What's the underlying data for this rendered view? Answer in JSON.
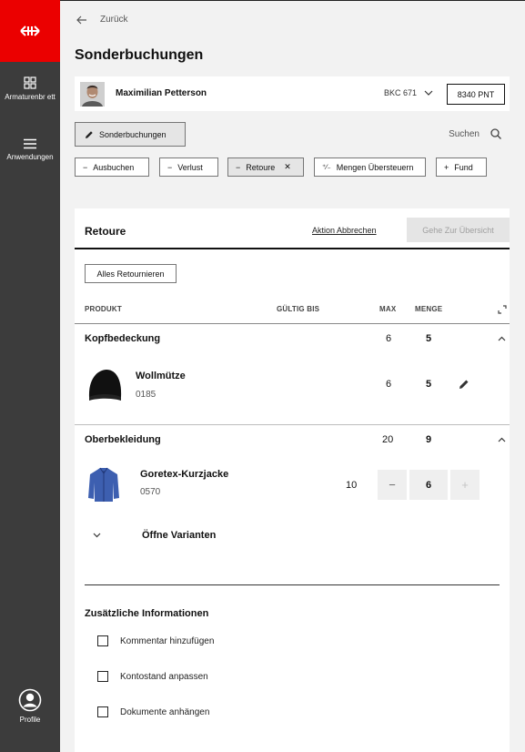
{
  "sidebar": {
    "logo_icon": "sbb-arrows-icon",
    "items": [
      {
        "label": "Armaturenbr ett",
        "icon": "dashboard-icon"
      },
      {
        "label": "Anwendungen",
        "icon": "menu-icon"
      }
    ],
    "profile": {
      "label": "Profile",
      "icon": "user-circle-icon"
    }
  },
  "header": {
    "back_label": "Zurück",
    "title": "Sonderbuchungen"
  },
  "user": {
    "name": "Maximilian Petterson",
    "account": "BKC 671",
    "points": "8340 PNT"
  },
  "toolbar": {
    "active_tab": "Sonderbuchungen",
    "search_label": "Suchen"
  },
  "chips": [
    {
      "label": "Ausbuchen",
      "icon": "minus"
    },
    {
      "label": "Verlust",
      "icon": "minus"
    },
    {
      "label": "Retoure",
      "icon": "minus",
      "active": true
    },
    {
      "label": "Mengen Übersteuern",
      "icon": "plus-minus"
    },
    {
      "label": "Fund",
      "icon": "plus"
    }
  ],
  "panel": {
    "title": "Retoure",
    "abort_label": "Aktion Abbrechen",
    "overview_label": "Gehe Zur Übersicht",
    "return_all_label": "Alles Retournieren",
    "columns": {
      "product": "PRODUKT",
      "valid_until": "GÜLTIG BIS",
      "max": "MAX",
      "quantity": "MENGE"
    }
  },
  "groups": [
    {
      "name": "Kopfbedeckung",
      "max": "6",
      "qty": "5",
      "product": {
        "name": "Wollmütze",
        "code": "0185",
        "max": "6",
        "qty": "5"
      }
    },
    {
      "name": "Oberbekleidung",
      "max": "20",
      "qty": "9",
      "product": {
        "name": "Goretex-Kurzjacke",
        "code": "0570",
        "max": "10",
        "qty": "6",
        "minus": "−",
        "plus": "+"
      },
      "variants_label": "Öffne Varianten"
    }
  ],
  "extra": {
    "title": "Zusätzliche Informationen",
    "options": [
      "Kommentar hinzufügen",
      "Kontostand anpassen",
      "Dokumente anhängen"
    ]
  },
  "colors": {
    "brand_red": "#eb0000",
    "sidebar": "#3c3c3c",
    "jacket_blue": "#3d5fb0"
  }
}
